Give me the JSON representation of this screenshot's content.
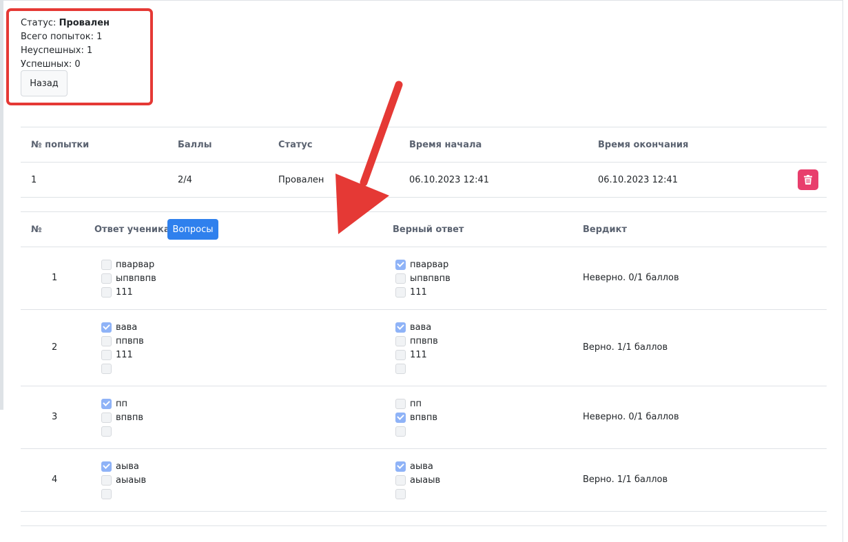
{
  "summary": {
    "status_label": "Статус:",
    "status_value": "Провален",
    "total_attempts": "Всего попыток: 1",
    "failed": "Неуспешных: 1",
    "successful": "Успешных: 0",
    "back_button": "Назад"
  },
  "attempts_table": {
    "headers": [
      "№ попытки",
      "Баллы",
      "Статус",
      "Время начала",
      "Время окончания"
    ],
    "rows": [
      {
        "number": "1",
        "score": "2/4",
        "status": "Провален",
        "start": "06.10.2023 12:41",
        "end": "06.10.2023 12:41"
      }
    ],
    "delete_icon": "trash-icon"
  },
  "answers_table": {
    "headers": {
      "number": "№",
      "student_answer": "Ответ ученика",
      "correct_answer": "Верный ответ",
      "verdict": "Вердикт"
    },
    "questions_button": "Вопросы",
    "rows": [
      {
        "number": "1",
        "student": [
          {
            "label": "пварвар",
            "checked": false
          },
          {
            "label": "ыпвпвпв",
            "checked": false
          },
          {
            "label": "111",
            "checked": false
          }
        ],
        "correct": [
          {
            "label": "пварвар",
            "checked": true
          },
          {
            "label": "ыпвпвпв",
            "checked": false
          },
          {
            "label": "111",
            "checked": false
          }
        ],
        "verdict": "Неверно. 0/1 баллов"
      },
      {
        "number": "2",
        "student": [
          {
            "label": "вава",
            "checked": true
          },
          {
            "label": "ппвпв",
            "checked": false
          },
          {
            "label": "111",
            "checked": false
          },
          {
            "label": "",
            "checked": false
          }
        ],
        "correct": [
          {
            "label": "вава",
            "checked": true
          },
          {
            "label": "ппвпв",
            "checked": false
          },
          {
            "label": "111",
            "checked": false
          },
          {
            "label": "",
            "checked": false
          }
        ],
        "verdict": "Верно. 1/1 баллов"
      },
      {
        "number": "3",
        "student": [
          {
            "label": "пп",
            "checked": true
          },
          {
            "label": "впвпв",
            "checked": false
          },
          {
            "label": "",
            "checked": false
          }
        ],
        "correct": [
          {
            "label": "пп",
            "checked": false
          },
          {
            "label": "впвпв",
            "checked": true
          },
          {
            "label": "",
            "checked": false
          }
        ],
        "verdict": "Неверно. 0/1 баллов"
      },
      {
        "number": "4",
        "student": [
          {
            "label": "аыва",
            "checked": true
          },
          {
            "label": "аыаыв",
            "checked": false
          },
          {
            "label": "",
            "checked": false
          }
        ],
        "correct": [
          {
            "label": "аыва",
            "checked": true
          },
          {
            "label": "аыаыв",
            "checked": false
          },
          {
            "label": "",
            "checked": false
          }
        ],
        "verdict": "Верно. 1/1 баллов"
      }
    ]
  },
  "colors": {
    "highlight": "#e53935",
    "primary": "#2f80ed",
    "danger": "#e83e6c",
    "checked": "#8fb3f7"
  }
}
